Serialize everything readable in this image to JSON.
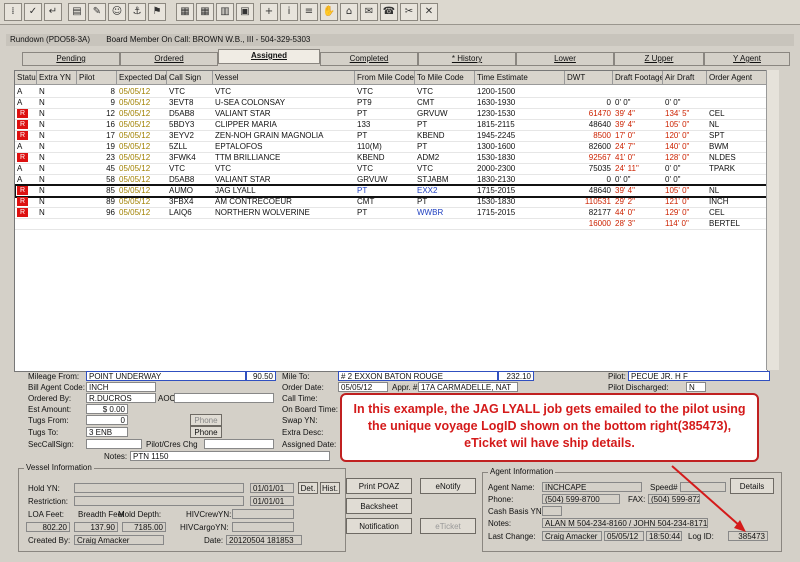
{
  "window": {
    "title": "Rundown (PDO58-3A)",
    "subtitle": "Board Member On Call: BROWN W.B., III - 504-329-5303"
  },
  "toolbar": {
    "icons": [
      "drag-icon",
      "check-icon",
      "return-icon",
      "chart-icon",
      "tools-icon",
      "person-icon",
      "ship-icon",
      "flag-icon",
      "doc-icon",
      "grid-icon",
      "grid2-icon",
      "box-icon",
      "plus-icon",
      "info-icon",
      "bars-icon",
      "hand-icon",
      "map-icon",
      "mail-icon",
      "phone-icon",
      "cloud-icon",
      "bolt-icon",
      "tag-icon",
      "close-icon"
    ]
  },
  "tabs": [
    {
      "label": "Pending",
      "active": false
    },
    {
      "label": "Ordered",
      "active": false
    },
    {
      "label": "Assigned",
      "active": true
    },
    {
      "label": "Completed",
      "active": false
    },
    {
      "label": "* History",
      "active": false
    },
    {
      "label": "Lower",
      "active": false
    },
    {
      "label": "Z Upper",
      "active": false
    },
    {
      "label": "Y Agent",
      "active": false
    }
  ],
  "grid": {
    "headers": [
      "Status",
      "Extra YN",
      "Pilot",
      "Expected Date",
      "Call Sign",
      "Vessel",
      "From Mile Code",
      "To Mile Code",
      "Time Estimate",
      "DWT",
      "Draft Footage",
      "Air Draft",
      "Order Agent"
    ],
    "rows": [
      [
        "A",
        "N",
        "8",
        "05/05/12",
        "VTC",
        "VTC",
        "VTC",
        "VTC",
        "1200-1500",
        "",
        "",
        "",
        ""
      ],
      [
        "A",
        "N",
        "9",
        "05/05/12",
        "3EVT8",
        "U-SEA COLONSAY",
        "PT9",
        "CMT",
        "1630-1930",
        "0",
        "0' 0\"",
        "0' 0\"",
        ""
      ],
      [
        "R",
        "N",
        "12",
        "05/05/12",
        "D5AB8",
        "VALIANT STAR",
        "PT",
        "GRVUW",
        "1230-1530",
        "61470",
        "39' 4\"",
        "134' 5\"",
        "CEL"
      ],
      [
        "R",
        "N",
        "16",
        "05/05/12",
        "5BDY3",
        "CLIPPER MARIA",
        "133",
        "PT",
        "1815-2115",
        "48640",
        "39' 4\"",
        "105' 0\"",
        "NL"
      ],
      [
        "R",
        "N",
        "17",
        "05/05/12",
        "3EYV2",
        "ZEN-NOH GRAIN MAGNOLIA",
        "PT",
        "KBEND",
        "1945-2245",
        "8500",
        "17' 0\"",
        "120' 0\"",
        "SPT"
      ],
      [
        "A",
        "N",
        "19",
        "05/05/12",
        "5ZLL",
        "EPTALOFOS",
        "110(M)",
        "PT",
        "1300-1600",
        "82600",
        "24' 7\"",
        "140' 0\"",
        "BWM"
      ],
      [
        "R",
        "N",
        "23",
        "05/05/12",
        "3FWK4",
        "TTM BRILLIANCE",
        "KBEND",
        "ADM2",
        "1530-1830",
        "92567",
        "41' 0\"",
        "128' 0\"",
        "NLDES"
      ],
      [
        "A",
        "N",
        "45",
        "05/05/12",
        "VTC",
        "VTC",
        "VTC",
        "VTC",
        "2000-2300",
        "75035",
        "24' 11\"",
        "0' 0\"",
        "TPARK"
      ],
      [
        "A",
        "N",
        "58",
        "05/05/12",
        "D5AB8",
        "VALIANT STAR",
        "GRVUW",
        "STJABM",
        "1830-2130",
        "0",
        "0' 0\"",
        "0' 0\"",
        ""
      ],
      [
        "R",
        "N",
        "85",
        "05/05/12",
        "AUMO",
        "JAG LYALL",
        "PT",
        "EXX2",
        "1715-2015",
        "48640",
        "39' 4\"",
        "105' 0\"",
        "NL"
      ],
      [
        "R",
        "N",
        "89",
        "05/05/12",
        "3FBX4",
        "AM CONTRECOEUR",
        "CMT",
        "PT",
        "1530-1830",
        "110531",
        "29' 2\"",
        "121' 0\"",
        "INCH"
      ],
      [
        "R",
        "N",
        "96",
        "05/05/12",
        "LAIQ6",
        "NORTHERN WOLVERINE",
        "PT",
        "WWBR",
        "1715-2015",
        "82177",
        "44' 0\"",
        "129' 0\"",
        "CEL"
      ],
      [
        "",
        "",
        "",
        "",
        "",
        "",
        "",
        "",
        "",
        "16000",
        "28' 3\"",
        "114' 0\"",
        "BERTEL"
      ]
    ]
  },
  "details": {
    "mileage_from_label": "Mileage From:",
    "mileage_from": "POINT UNDERWAY",
    "mileage_from_num": "90.50",
    "mile_to_label": "Mile To:",
    "mile_to": "# 2 EXXON BATON ROUGE",
    "mile_to_num": "232.10",
    "pilot_label": "Pilot:",
    "pilot": "PECUE JR. H F",
    "bill_agent_label": "Bill Agent Code:",
    "bill_agent": "INCH",
    "order_date_label": "Order Date:",
    "order_date": "05/05/12",
    "appr_label": "Appr. #1",
    "appr": "17A CARMADELLE, NAT",
    "pilot_discharged_label": "Pilot Discharged:",
    "pilot_discharged": "N",
    "ordered_by_label": "Ordered By:",
    "ordered_by": "R.DUCROS",
    "aoc_label": "AOC",
    "call_time_label": "Call Time:",
    "est_amount_label": "Est Amount:",
    "est_amount": "$ 0.00",
    "on_board_label": "On Board Time:",
    "tugs_from_label": "Tugs From:",
    "tugs_from": "0",
    "phone_label1": "Phone",
    "swap_label": "Swap YN:",
    "tugs_to_label": "Tugs To:",
    "tugs_to": "3 ENB",
    "phone_label2": "Phone",
    "extra_desc_label": "Extra Desc:",
    "sec_call_label": "SecCallSign:",
    "pilot_cres_label": "Pilot/Cres Chg",
    "assigned_date_label": "Assigned Date:",
    "notes_label": "Notes:",
    "notes": "PTN 1150"
  },
  "vessel_info": {
    "title": "Vessel Information",
    "hold_label": "Hold YN:",
    "hold_date": "01/01/01",
    "det_label": "Det.",
    "hist_label": "Hist.",
    "restriction_label": "Restriction:",
    "restriction_date": "01/01/01",
    "loa_label": "LOA Feet:",
    "breadth_label": "Breadth Feet",
    "mold_label": "Mold Depth:",
    "hiv_crew_label": "HIVCrewYN:",
    "loa": "802.20",
    "breadth": "137.90",
    "mold": "7185.00",
    "hiv_cargo_label": "HIVCargoYN:",
    "created_label": "Created By:",
    "created": "Craig Amacker",
    "date_label": "Date:",
    "date": "20120504 181853"
  },
  "buttons": {
    "print_poaz": "Print POAZ",
    "enotify": "eNotify",
    "backsheet": "Backsheet",
    "notification": "Notification",
    "eticket": "eTicket",
    "details": "Details"
  },
  "agent_info": {
    "title": "Agent Information",
    "agent_name_label": "Agent Name:",
    "agent_name": "INCHCAPE",
    "speed_label": "Speed#",
    "phone_label": "Phone:",
    "phone": "(504) 599-8700",
    "fax_label": "FAX:",
    "fax": "(504) 599-8725",
    "cash_label": "Cash Basis YN:",
    "notes_label": "Notes:",
    "notes": "ALAN M 504-234-8160 / JOHN 504-234-8171",
    "last_change_label": "Last Change:",
    "last_user": "Craig Amacker",
    "last_date": "05/05/12",
    "last_time": "18:50:44",
    "logid_label": "Log ID:",
    "logid": "385473"
  },
  "annotation": "In this example, the JAG LYALL job gets emailed to the pilot using the unique voyage LogID shown on the bottom right(385473), eTicket wil have ship details.",
  "colors": {
    "annotation": "#d41a1a",
    "status_red": "#dd1111",
    "selected_row_outline": "#111111"
  }
}
